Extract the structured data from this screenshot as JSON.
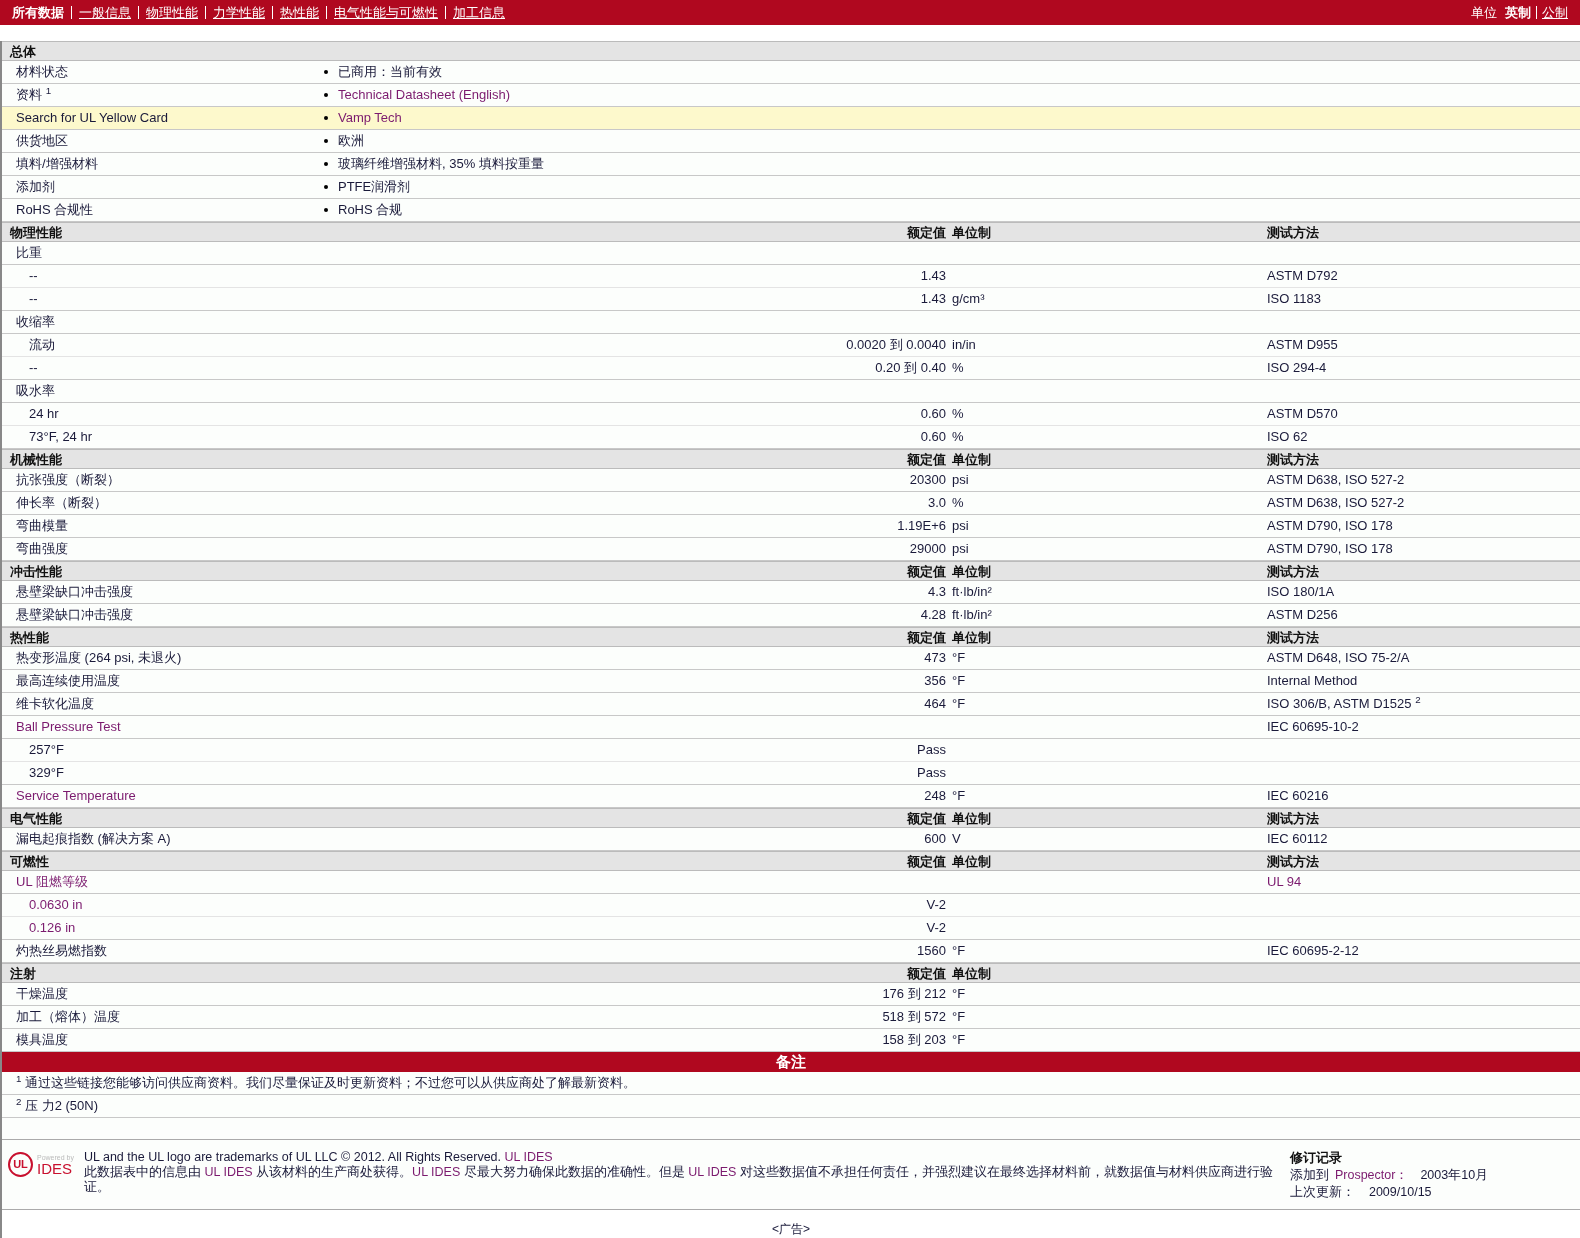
{
  "nav": {
    "tabs": [
      {
        "label": "所有数据",
        "selected": true
      },
      {
        "label": "一般信息",
        "selected": false
      },
      {
        "label": "物理性能",
        "selected": false
      },
      {
        "label": "力学性能",
        "selected": false
      },
      {
        "label": "热性能",
        "selected": false
      },
      {
        "label": "电气性能与可燃性",
        "selected": false
      },
      {
        "label": "加工信息",
        "selected": false
      }
    ],
    "units_label": "单位",
    "units": [
      {
        "label": "英制",
        "selected": true
      },
      {
        "label": "公制",
        "selected": false
      }
    ]
  },
  "general": {
    "title": "总体",
    "rows": [
      {
        "label": "材料状态",
        "value": "已商用：当前有效",
        "value_link": false,
        "highlighted": false
      },
      {
        "label": "资料 $^{1}$",
        "value": "Technical Datasheet (English)",
        "value_link": true,
        "highlighted": false
      },
      {
        "label": "Search for UL Yellow Card",
        "value": "Vamp Tech",
        "value_link": true,
        "highlighted": true
      },
      {
        "label": "供货地区",
        "value": "欧洲",
        "value_link": false,
        "highlighted": false
      },
      {
        "label": "填料/增强材料",
        "value": "玻璃纤维增强材料, 35% 填料按重量",
        "value_link": false,
        "highlighted": false
      },
      {
        "label": "添加剂",
        "value": "PTFE润滑剂",
        "value_link": false,
        "highlighted": false
      },
      {
        "label": "RoHS 合规性",
        "value": "RoHS 合规",
        "value_link": false,
        "highlighted": false
      }
    ]
  },
  "sections": [
    {
      "title": "物理性能",
      "headers": {
        "value": "额定值",
        "unit": "单位制",
        "method": "测试方法"
      },
      "rows": [
        {
          "label": "比重",
          "link": false,
          "children": [
            {
              "label": "--",
              "value": "1.43",
              "method": "ASTM D792",
              "link": false
            },
            {
              "label": "--",
              "value": "1.43",
              "unit": "g/cm³",
              "method": "ISO 1183",
              "link": false
            }
          ]
        },
        {
          "label": "收缩率",
          "link": false,
          "children": [
            {
              "label": "流动",
              "value": "0.0020 到  0.0040",
              "unit": "in/in",
              "method": "ASTM D955",
              "link": false
            },
            {
              "label": "--",
              "value": "0.20 到  0.40",
              "unit": "%",
              "method": "ISO 294-4",
              "link": false
            }
          ]
        },
        {
          "label": "吸水率",
          "link": false,
          "children": [
            {
              "label": "24 hr",
              "value": "0.60",
              "unit": "%",
              "method": "ASTM D570",
              "link": false
            },
            {
              "label": "73°F, 24 hr",
              "value": "0.60",
              "unit": "%",
              "method": "ISO 62",
              "link": false
            }
          ]
        }
      ]
    },
    {
      "title": "机械性能",
      "headers": {
        "value": "额定值",
        "unit": "单位制",
        "method": "测试方法"
      },
      "rows": [
        {
          "label": "抗张强度（断裂）",
          "value": "20300",
          "unit": "psi",
          "method": "ASTM D638, ISO 527-2",
          "link": false
        },
        {
          "label": "伸长率（断裂）",
          "value": "3.0",
          "unit": "%",
          "method": "ASTM D638, ISO 527-2",
          "link": false
        },
        {
          "label": "弯曲模量",
          "value": "1.19E+6",
          "unit": "psi",
          "method": "ASTM D790, ISO 178",
          "link": false
        },
        {
          "label": "弯曲强度",
          "value": "29000",
          "unit": "psi",
          "method": "ASTM D790, ISO 178",
          "link": false
        }
      ]
    },
    {
      "title": "冲击性能",
      "headers": {
        "value": "额定值",
        "unit": "单位制",
        "method": "测试方法"
      },
      "rows": [
        {
          "label": "悬壁梁缺口冲击强度",
          "value": "4.3",
          "unit": "ft·lb/in²",
          "method": "ISO 180/1A",
          "link": false
        },
        {
          "label": "悬壁梁缺口冲击强度",
          "value": "4.28",
          "unit": "ft·lb/in²",
          "method": "ASTM D256",
          "link": false
        }
      ]
    },
    {
      "title": "热性能",
      "headers": {
        "value": "额定值",
        "unit": "单位制",
        "method": "测试方法"
      },
      "rows": [
        {
          "label": "热变形温度  (264 psi, 未退火)",
          "value": "473",
          "unit": "°F",
          "method": "ASTM D648, ISO 75-2/A",
          "link": false
        },
        {
          "label": "最高连续使用温度",
          "value": "356",
          "unit": "°F",
          "method": "Internal Method",
          "link": false
        },
        {
          "label": "维卡软化温度",
          "value": "464",
          "unit": "°F",
          "method": "ISO 306/B, ASTM D1525 $^{2}$",
          "link": false
        },
        {
          "label": "Ball Pressure Test",
          "method": "IEC 60695-10-2",
          "link": true,
          "children": [
            {
              "label": "257°F",
              "value": "Pass",
              "link": false
            },
            {
              "label": "329°F",
              "value": "Pass",
              "link": false
            }
          ]
        },
        {
          "label": "Service Temperature",
          "value": "248",
          "unit": "°F",
          "method": "IEC 60216",
          "link": true
        }
      ]
    },
    {
      "title": "电气性能",
      "headers": {
        "value": "额定值",
        "unit": "单位制",
        "method": "测试方法"
      },
      "rows": [
        {
          "label": "漏电起痕指数  (解决方案  A)",
          "value": "600",
          "unit": "V",
          "method": "IEC 60112",
          "link": false
        }
      ]
    },
    {
      "title": "可燃性",
      "headers": {
        "value": "额定值",
        "unit": "单位制",
        "method": "测试方法"
      },
      "rows": [
        {
          "label": "UL 阻燃等级",
          "method": "UL 94",
          "method_link": true,
          "link": true,
          "children": [
            {
              "label": "0.0630 in",
              "value": "V-2",
              "link": true
            },
            {
              "label": "0.126 in",
              "value": "V-2",
              "link": true
            }
          ]
        },
        {
          "label": "灼热丝易燃指数",
          "value": "1560",
          "unit": "°F",
          "method": "IEC 60695-2-12",
          "link": false
        }
      ]
    },
    {
      "title": "注射",
      "headers": {
        "value": "额定值",
        "unit": "单位制"
      },
      "rows": [
        {
          "label": "干燥温度",
          "value": "176 到  212",
          "unit": "°F",
          "link": false
        },
        {
          "label": "加工（熔体）温度",
          "value": "518 到  572",
          "unit": "°F",
          "link": false
        },
        {
          "label": "模具温度",
          "value": "158 到  203",
          "unit": "°F",
          "link": false
        }
      ]
    }
  ],
  "notes": {
    "title": "备注",
    "items": [
      "$^{1}$ 通过这些链接您能够访问供应商资料。我们尽量保证及时更新资料；不过您可以从供应商处了解最新资料。",
      "$^{2}$ 压  力2 (50N)"
    ]
  },
  "footer": {
    "logo": {
      "mark": "UL",
      "powered": "Powered by",
      "name": "IDES"
    },
    "trademark": [
      {
        "text": "UL and the UL logo are trademarks of UL LLC © 2012. All Rights Reserved. ",
        "kind": "text"
      },
      {
        "text": "UL IDES",
        "kind": "link"
      }
    ],
    "disclaimer": [
      {
        "text": "此数据表中的信息由 ",
        "kind": "text"
      },
      {
        "text": "UL IDES",
        "kind": "link"
      },
      {
        "text": " 从该材料的生产商处获得。",
        "kind": "text"
      },
      {
        "text": "UL IDES",
        "kind": "link"
      },
      {
        "text": " 尽最大努力确保此数据的准确性。但是 ",
        "kind": "text"
      },
      {
        "text": "UL IDES",
        "kind": "link"
      },
      {
        "text": " 对这些数据值不承担任何责任，并强烈建议在最终选择材料前，就数据值与材料供应商进行验证。",
        "kind": "text"
      }
    ],
    "revision": {
      "title": "修订记录",
      "added_label": "添加到",
      "added_link": "Prospector：",
      "added_value": "2003年10月",
      "updated_label": "上次更新：",
      "updated_value": "2009/10/15"
    }
  },
  "ad": "<广告>"
}
